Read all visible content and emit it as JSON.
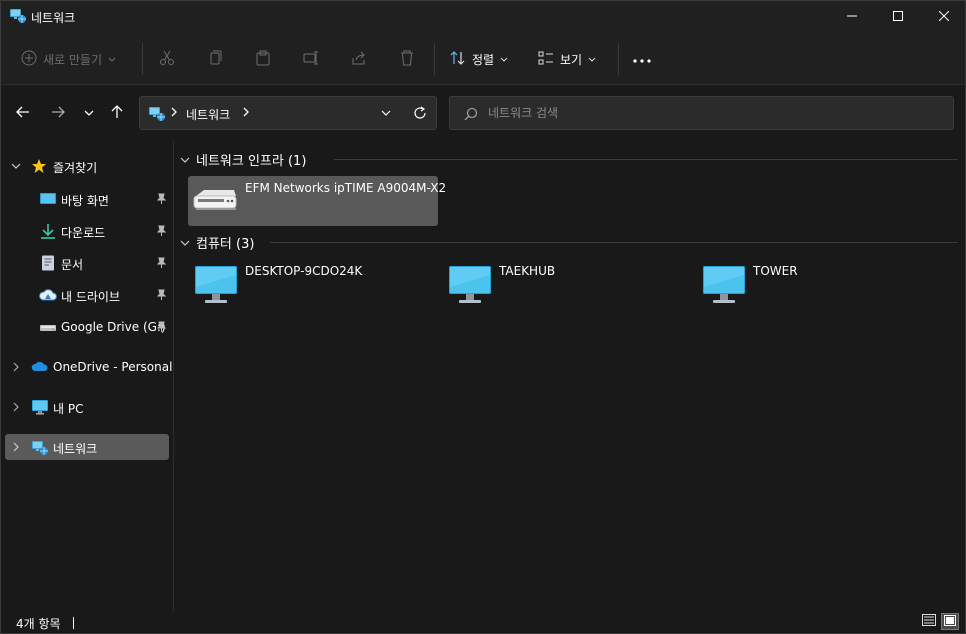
{
  "window": {
    "title": "네트워크",
    "controls": {
      "minimize": "minimize-icon",
      "maximize": "maximize-icon",
      "close": "close-icon"
    }
  },
  "commandbar": {
    "new_label": "새로 만들기",
    "sort_label": "정렬",
    "view_label": "보기",
    "icons": [
      "cut-icon",
      "copy-icon",
      "paste-icon",
      "rename-icon",
      "share-icon",
      "delete-icon",
      "more-icon"
    ]
  },
  "address": {
    "path": "네트워크",
    "icons": [
      "back-icon",
      "forward-icon",
      "recent-dropdown-icon",
      "up-icon",
      "network-icon",
      "refresh-icon"
    ]
  },
  "search": {
    "placeholder": "네트워크 검색",
    "value": ""
  },
  "sidebar": {
    "quick_access": "즐겨찾기",
    "items": [
      {
        "label": "바탕 화면",
        "icon": "desktop-icon",
        "pinned": true
      },
      {
        "label": "다운로드",
        "icon": "download-icon",
        "pinned": true
      },
      {
        "label": "문서",
        "icon": "document-icon",
        "pinned": true
      },
      {
        "label": "내 드라이브",
        "icon": "drive-icon",
        "pinned": true
      },
      {
        "label": "Google Drive (G:)",
        "icon": "google-drive-icon",
        "pinned": true
      }
    ],
    "onedrive": "OneDrive - Personal",
    "this_pc": "내 PC",
    "network": "네트워크"
  },
  "content": {
    "groups": [
      {
        "title": "네트워크 인프라 (1)",
        "items": [
          {
            "label": "EFM Networks ipTIME A9004M-X2",
            "icon": "router-icon",
            "selected": true
          }
        ]
      },
      {
        "title": "컴퓨터 (3)",
        "items": [
          {
            "label": "DESKTOP-9CDO24K",
            "icon": "computer-icon"
          },
          {
            "label": "TAEKHUB",
            "icon": "computer-icon"
          },
          {
            "label": "TOWER",
            "icon": "computer-icon"
          }
        ]
      }
    ]
  },
  "status": {
    "item_count": "4개 항목",
    "views": [
      "details-view-icon",
      "tiles-view-icon"
    ]
  },
  "colors": {
    "background": "#191919",
    "chrome": "#202020",
    "selection": "#595959",
    "accent_star": "#f5c518",
    "monitor": "#3cb8e8"
  }
}
